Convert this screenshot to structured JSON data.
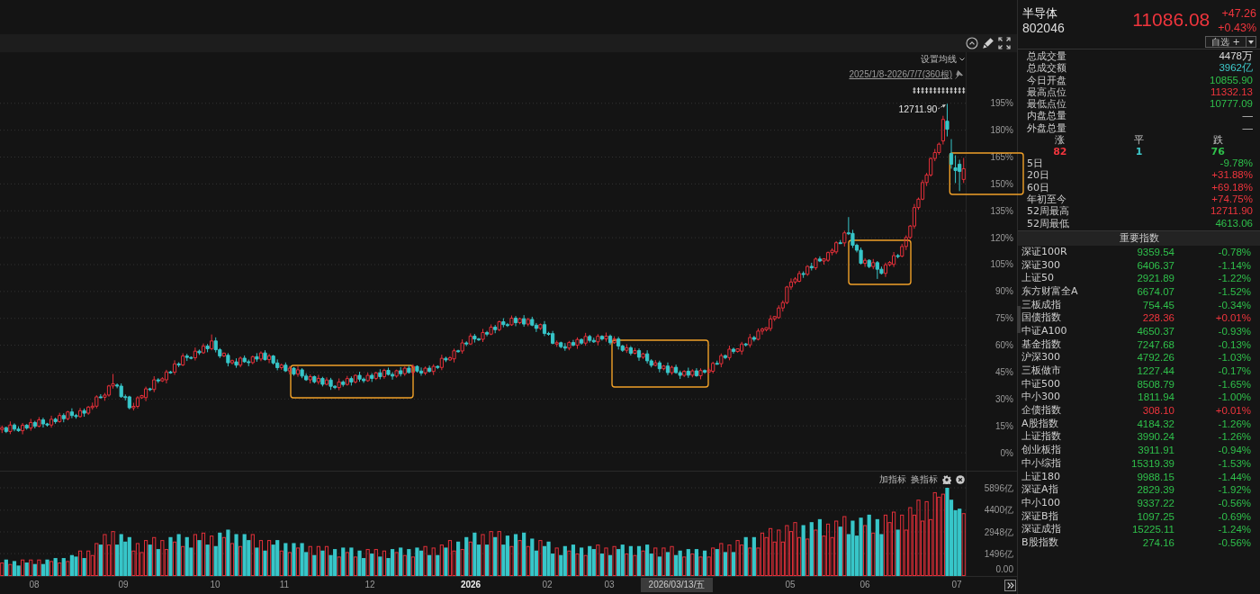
{
  "price_chart": {
    "ma_setting": "设置均线",
    "date_range": "2025/1/8-2026/7/7(360根)",
    "chart_data": {
      "type": "candlestick",
      "grid": true,
      "ylim": [
        -10,
        223.5
      ],
      "yticks": [
        {
          "value": 195,
          "label": "195%"
        },
        {
          "value": 180,
          "label": "180%"
        },
        {
          "value": 165,
          "label": "165%"
        },
        {
          "value": 150,
          "label": "150%"
        },
        {
          "value": 135,
          "label": "135%"
        },
        {
          "value": 120,
          "label": "120%"
        },
        {
          "value": 105,
          "label": "105%"
        },
        {
          "value": 90,
          "label": "90%"
        },
        {
          "value": 75,
          "label": "75%"
        },
        {
          "value": 60,
          "label": "60%"
        },
        {
          "value": 45,
          "label": "45%"
        },
        {
          "value": 30,
          "label": "30%"
        },
        {
          "value": 15,
          "label": "15%"
        },
        {
          "value": 0,
          "label": "0%"
        }
      ],
      "annotations": [
        {
          "text": "12711.90"
        }
      ],
      "categories": [
        null,
        null,
        null,
        null,
        null,
        null,
        null,
        null,
        null,
        null,
        null,
        null,
        null,
        null,
        null,
        null,
        null,
        null,
        null,
        null,
        null,
        null,
        null,
        null,
        null,
        null,
        null,
        null,
        null,
        null,
        null,
        null,
        null,
        null,
        null,
        null,
        null,
        null,
        null,
        null,
        null,
        null,
        null,
        null,
        null,
        null,
        null,
        null,
        null,
        null,
        null,
        null,
        null,
        null,
        null,
        null,
        null,
        null,
        null,
        null,
        null,
        null,
        null,
        null,
        null,
        null,
        null,
        null,
        null,
        null,
        null,
        null,
        null,
        null,
        null,
        null,
        null,
        null,
        null,
        null,
        null,
        null,
        null,
        null,
        null,
        null,
        null,
        null,
        null,
        null,
        null,
        null,
        null,
        null,
        null,
        null,
        null,
        null,
        null,
        null,
        null,
        null,
        null,
        null,
        null,
        null,
        null,
        null,
        null,
        null,
        null,
        null,
        null,
        null,
        null,
        null,
        null,
        null,
        null,
        null,
        null,
        null,
        null,
        null,
        null,
        null,
        null,
        null,
        null,
        null,
        null,
        null,
        null,
        null,
        null,
        null,
        null,
        null,
        null,
        null,
        null,
        null,
        null,
        null,
        null,
        null,
        null,
        null,
        null,
        null,
        null,
        null,
        null,
        null,
        null,
        null,
        null,
        null,
        null,
        null,
        null,
        null,
        null,
        null,
        null,
        null,
        null,
        null,
        null,
        null,
        null,
        null,
        null,
        null,
        null,
        null,
        null,
        null,
        null,
        null,
        null,
        null,
        null,
        null,
        null,
        null,
        null,
        null,
        null,
        null,
        null,
        null,
        null,
        null,
        null,
        null,
        null,
        null,
        null,
        null,
        null,
        null,
        null,
        null,
        null,
        null,
        null,
        null,
        null,
        null,
        null,
        null,
        null,
        null,
        null,
        null,
        null,
        null,
        null,
        null,
        null,
        null,
        null,
        null,
        null,
        null,
        null,
        null,
        null,
        null,
        null,
        null,
        null,
        null,
        null
      ],
      "ohlc": [
        [
          13.0,
          15.2,
          11.0,
          14.0
        ],
        [
          14.0,
          14.6,
          11.0,
          11.9
        ],
        [
          11.9,
          17.5,
          10.4,
          15.5
        ],
        [
          15.5,
          16.4,
          12.0,
          13.2
        ],
        [
          13.2,
          14.7,
          11.7,
          12.3
        ],
        [
          12.3,
          16.6,
          10.3,
          15.4
        ],
        [
          15.4,
          16.0,
          12.9,
          13.8
        ],
        [
          13.8,
          18.9,
          12.3,
          16.9
        ],
        [
          16.9,
          17.8,
          13.6,
          14.8
        ],
        [
          14.8,
          19.9,
          14.2,
          18.4
        ],
        [
          18.4,
          19.6,
          14.1,
          16.1
        ],
        [
          16.1,
          16.7,
          14.6,
          15.5
        ],
        [
          15.5,
          20.7,
          14.0,
          18.7
        ],
        [
          18.7,
          19.6,
          16.2,
          17.4
        ],
        [
          17.4,
          22.3,
          16.8,
          20.8
        ],
        [
          20.8,
          22.0,
          17.0,
          19.0
        ],
        [
          19.0,
          23.4,
          18.1,
          22.8
        ],
        [
          22.8,
          24.8,
          19.3,
          20.8
        ],
        [
          20.8,
          21.7,
          19.0,
          20.2
        ],
        [
          20.2,
          25.0,
          19.6,
          23.5
        ],
        [
          23.5,
          24.7,
          20.1,
          22.1
        ],
        [
          22.1,
          26.1,
          21.2,
          25.5
        ],
        [
          25.5,
          28.0,
          24.0,
          26.0
        ],
        [
          26.0,
          32.1,
          24.8,
          31.2
        ],
        [
          31.2,
          32.7,
          30.4,
          31.0
        ],
        [
          31.0,
          33.4,
          29.0,
          32.2
        ],
        [
          32.2,
          37.9,
          31.3,
          37.3
        ],
        [
          37.3,
          44.0,
          35.8,
          38.5
        ],
        [
          37.8,
          38.7,
          36.0,
          37.2
        ],
        [
          37.2,
          38.7,
          30.7,
          31.3
        ],
        [
          31.3,
          32.5,
          29.2,
          31.2
        ],
        [
          31.2,
          31.8,
          24.2,
          25.1
        ],
        [
          25.1,
          27.9,
          23.6,
          25.9
        ],
        [
          25.9,
          31.6,
          24.7,
          30.7
        ],
        [
          30.7,
          32.3,
          30.1,
          31.9
        ],
        [
          30.8,
          36.9,
          28.8,
          35.7
        ],
        [
          35.7,
          36.3,
          34.4,
          35.3
        ],
        [
          35.3,
          42.7,
          33.8,
          40.7
        ],
        [
          40.7,
          41.6,
          38.9,
          40.1
        ],
        [
          40.1,
          42.2,
          39.5,
          41.3
        ],
        [
          40.7,
          46.3,
          38.7,
          45.1
        ],
        [
          45.1,
          45.7,
          44.1,
          45.0
        ],
        [
          45.0,
          51.6,
          43.5,
          49.6
        ],
        [
          49.6,
          50.5,
          47.8,
          49.0
        ],
        [
          49.0,
          55.5,
          48.4,
          54.0
        ],
        [
          54.0,
          55.2,
          51.2,
          53.2
        ],
        [
          53.2,
          53.8,
          52.1,
          53.0
        ],
        [
          53.0,
          58.7,
          51.5,
          56.7
        ],
        [
          56.7,
          57.6,
          54.6,
          55.8
        ],
        [
          55.8,
          61.0,
          55.2,
          59.5
        ],
        [
          59.5,
          60.7,
          56.1,
          58.1
        ],
        [
          58.1,
          66.0,
          57.2,
          62.4
        ],
        [
          62.4,
          64.4,
          56.0,
          57.5
        ],
        [
          57.5,
          58.4,
          52.8,
          54.0
        ],
        [
          54.0,
          55.9,
          53.4,
          55.6
        ],
        [
          54.4,
          55.6,
          48.2,
          50.2
        ],
        [
          50.2,
          52.0,
          49.3,
          51.4
        ],
        [
          50.7,
          52.7,
          47.4,
          48.9
        ],
        [
          48.9,
          53.7,
          47.7,
          52.8
        ],
        [
          52.8,
          54.3,
          50.2,
          50.8
        ],
        [
          50.8,
          52.0,
          48.3,
          50.3
        ],
        [
          50.3,
          54.2,
          49.4,
          53.6
        ],
        [
          53.6,
          55.6,
          50.8,
          52.3
        ],
        [
          52.3,
          56.6,
          51.1,
          55.7
        ],
        [
          55.7,
          57.2,
          51.4,
          52.0
        ],
        [
          52.0,
          55.2,
          50.0,
          54.0
        ],
        [
          54.0,
          54.6,
          49.2,
          50.1
        ],
        [
          50.1,
          52.1,
          46.0,
          47.5
        ],
        [
          47.5,
          49.8,
          46.3,
          48.9
        ],
        [
          48.9,
          50.4,
          45.1,
          45.7
        ],
        [
          45.7,
          48.4,
          43.7,
          47.2
        ],
        [
          47.2,
          47.8,
          43.0,
          43.9
        ],
        [
          43.9,
          48.3,
          42.4,
          46.3
        ],
        [
          46.3,
          47.2,
          41.6,
          42.8
        ],
        [
          42.8,
          44.3,
          40.1,
          40.7
        ],
        [
          40.7,
          43.7,
          38.7,
          42.5
        ],
        [
          42.5,
          43.1,
          38.7,
          39.6
        ],
        [
          39.6,
          43.5,
          38.1,
          41.5
        ],
        [
          41.5,
          42.4,
          37.0,
          38.2
        ],
        [
          38.2,
          42.1,
          37.6,
          40.6
        ],
        [
          40.6,
          41.8,
          35.1,
          37.1
        ],
        [
          37.1,
          37.7,
          35.5,
          36.4
        ],
        [
          36.4,
          41.5,
          34.9,
          39.5
        ],
        [
          39.5,
          40.4,
          36.9,
          38.1
        ],
        [
          38.1,
          42.9,
          37.5,
          41.4
        ],
        [
          41.4,
          42.6,
          37.5,
          39.5
        ],
        [
          39.5,
          43.8,
          38.6,
          43.2
        ],
        [
          43.2,
          45.2,
          39.6,
          41.1
        ],
        [
          41.1,
          42.0,
          39.0,
          40.2
        ],
        [
          40.2,
          44.7,
          39.6,
          43.2
        ],
        [
          43.2,
          44.4,
          39.5,
          41.5
        ],
        [
          41.5,
          45.2,
          40.6,
          44.6
        ],
        [
          44.6,
          46.6,
          41.0,
          42.5
        ],
        [
          42.5,
          46.9,
          41.3,
          46.0
        ],
        [
          46.0,
          47.5,
          43.1,
          43.7
        ],
        [
          43.7,
          44.9,
          40.8,
          42.8
        ],
        [
          42.8,
          46.4,
          41.9,
          45.8
        ],
        [
          45.8,
          47.8,
          42.6,
          44.1
        ],
        [
          44.1,
          48.1,
          42.9,
          47.2
        ],
        [
          47.2,
          48.7,
          44.2,
          44.8
        ],
        [
          44.8,
          49.4,
          42.8,
          48.2
        ],
        [
          48.2,
          48.8,
          44.7,
          45.6
        ],
        [
          45.6,
          47.6,
          43.0,
          44.5
        ],
        [
          44.5,
          48.1,
          43.3,
          47.2
        ],
        [
          47.2,
          48.7,
          44.8,
          45.4
        ],
        [
          45.4,
          49.4,
          43.4,
          48.2
        ],
        [
          48.2,
          48.8,
          46.7,
          47.6
        ],
        [
          47.6,
          54.7,
          46.1,
          52.7
        ],
        [
          52.7,
          53.6,
          50.6,
          51.8
        ],
        [
          51.8,
          53.9,
          51.2,
          53.0
        ],
        [
          52.4,
          58.1,
          50.4,
          56.9
        ],
        [
          56.9,
          57.5,
          55.9,
          56.8
        ],
        [
          56.8,
          63.3,
          55.3,
          61.3
        ],
        [
          61.3,
          62.2,
          59.5,
          60.7
        ],
        [
          60.7,
          66.6,
          60.1,
          65.1
        ],
        [
          65.1,
          66.3,
          61.5,
          63.5
        ],
        [
          63.5,
          64.1,
          62.4,
          63.3
        ],
        [
          63.3,
          69.1,
          61.8,
          67.1
        ],
        [
          67.1,
          68.0,
          65.0,
          66.2
        ],
        [
          66.2,
          71.6,
          65.6,
          70.1
        ],
        [
          70.1,
          71.3,
          66.7,
          68.7
        ],
        [
          68.7,
          73.7,
          67.8,
          73.1
        ],
        [
          73.1,
          75.1,
          70.0,
          71.5
        ],
        [
          71.5,
          72.4,
          70.2,
          71.4
        ],
        [
          71.4,
          76.6,
          70.8,
          75.1
        ],
        [
          75.1,
          76.3,
          70.6,
          72.6
        ],
        [
          72.6,
          75.4,
          71.7,
          74.8
        ],
        [
          74.8,
          76.8,
          70.3,
          71.8
        ],
        [
          71.8,
          75.3,
          70.6,
          74.4
        ],
        [
          74.4,
          75.9,
          70.6,
          71.2
        ],
        [
          71.2,
          72.4,
          67.4,
          69.4
        ],
        [
          69.4,
          72.1,
          68.5,
          71.5
        ],
        [
          71.5,
          73.5,
          65.1,
          66.6
        ],
        [
          66.6,
          67.5,
          65.3,
          66.5
        ],
        [
          66.5,
          68.0,
          60.5,
          61.1
        ],
        [
          61.1,
          62.6,
          59.1,
          61.4
        ],
        [
          61.4,
          62.0,
          58.3,
          59.2
        ],
        [
          59.2,
          61.2,
          56.9,
          58.4
        ],
        [
          58.4,
          62.4,
          57.2,
          61.5
        ],
        [
          61.5,
          63.0,
          59.4,
          60.0
        ],
        [
          60.0,
          64.4,
          58.0,
          63.2
        ],
        [
          63.2,
          63.8,
          60.3,
          61.2
        ],
        [
          61.2,
          66.9,
          59.7,
          64.9
        ],
        [
          64.9,
          65.8,
          61.5,
          62.7
        ],
        [
          62.7,
          64.2,
          61.3,
          61.9
        ],
        [
          61.9,
          66.2,
          59.9,
          65.0
        ],
        [
          65.0,
          65.6,
          62.6,
          63.5
        ],
        [
          63.5,
          67.1,
          62.0,
          65.1
        ],
        [
          65.1,
          66.0,
          60.2,
          61.4
        ],
        [
          61.4,
          65.0,
          60.8,
          63.5
        ],
        [
          63.5,
          64.7,
          57.6,
          59.6
        ],
        [
          59.6,
          60.2,
          56.3,
          57.2
        ],
        [
          57.2,
          60.6,
          55.7,
          58.6
        ],
        [
          58.6,
          59.5,
          54.3,
          55.5
        ],
        [
          55.5,
          58.5,
          54.9,
          57.0
        ],
        [
          57.0,
          58.2,
          51.3,
          53.3
        ],
        [
          53.3,
          55.8,
          52.4,
          55.2
        ],
        [
          55.2,
          57.2,
          49.8,
          51.3
        ],
        [
          51.3,
          52.2,
          47.6,
          48.8
        ],
        [
          48.8,
          51.7,
          48.2,
          50.2
        ],
        [
          50.2,
          51.4,
          44.9,
          46.9
        ],
        [
          46.9,
          49.0,
          46.0,
          48.4
        ],
        [
          48.4,
          50.4,
          43.2,
          44.7
        ],
        [
          44.7,
          48.6,
          43.5,
          47.7
        ],
        [
          47.7,
          49.2,
          44.1,
          44.7
        ],
        [
          44.7,
          45.9,
          41.2,
          43.2
        ],
        [
          43.2,
          46.1,
          42.3,
          45.5
        ],
        [
          45.5,
          47.5,
          41.8,
          43.3
        ],
        [
          43.3,
          46.6,
          42.1,
          45.7
        ],
        [
          45.7,
          47.2,
          42.4,
          43.0
        ],
        [
          43.0,
          47.1,
          41.0,
          45.9
        ],
        [
          45.9,
          46.5,
          44.1,
          45.0
        ],
        [
          45.0,
          47.5,
          43.5,
          46.2
        ],
        [
          45.5,
          50.8,
          44.3,
          49.9
        ],
        [
          49.9,
          51.4,
          49.1,
          49.7
        ],
        [
          49.7,
          55.4,
          47.7,
          54.2
        ],
        [
          54.2,
          54.8,
          52.2,
          53.1
        ],
        [
          53.1,
          59.8,
          51.6,
          57.8
        ],
        [
          57.8,
          58.7,
          55.3,
          56.5
        ],
        [
          56.5,
          58.2,
          55.9,
          58.0
        ],
        [
          56.7,
          61.9,
          54.7,
          60.7
        ],
        [
          60.7,
          61.3,
          59.3,
          60.2
        ],
        [
          60.2,
          66.3,
          58.7,
          64.3
        ],
        [
          64.3,
          65.2,
          62.1,
          63.3
        ],
        [
          63.3,
          69.4,
          62.7,
          67.9
        ],
        [
          67.9,
          69.8,
          65.9,
          69.0
        ],
        [
          68.6,
          69.9,
          67.7,
          69.8
        ],
        [
          69.3,
          76.7,
          67.8,
          74.7
        ],
        [
          74.7,
          76.3,
          73.5,
          76.0
        ],
        [
          75.4,
          82.3,
          74.8,
          80.8
        ],
        [
          80.8,
          85.0,
          78.8,
          83.8
        ],
        [
          83.8,
          93.1,
          82.9,
          92.5
        ],
        [
          92.5,
          97.3,
          91.0,
          95.3
        ],
        [
          95.3,
          98.0,
          94.1,
          97.0
        ],
        [
          95.7,
          101.5,
          95.1,
          100.0
        ],
        [
          100.0,
          101.2,
          97.6,
          99.6
        ],
        [
          99.6,
          104.6,
          98.7,
          104.0
        ],
        [
          104.0,
          106.0,
          101.7,
          103.2
        ],
        [
          103.2,
          109.0,
          102.0,
          108.1
        ],
        [
          108.1,
          109.6,
          106.4,
          107.0
        ],
        [
          107.0,
          108.6,
          105.0,
          108.2
        ],
        [
          107.4,
          112.3,
          106.5,
          111.7
        ],
        [
          111.7,
          114.1,
          110.2,
          113.0
        ],
        [
          112.1,
          118.1,
          110.9,
          117.2
        ],
        [
          117.2,
          118.7,
          116.5,
          117.1
        ],
        [
          117.1,
          123.9,
          115.1,
          122.7
        ],
        [
          122.7,
          131.5,
          121.5,
          122.4
        ],
        [
          122.4,
          124.4,
          114.3,
          115.8
        ],
        [
          115.8,
          116.7,
          111.8,
          113.0
        ],
        [
          113.0,
          114.5,
          105.1,
          105.7
        ],
        [
          105.7,
          108.6,
          103.7,
          107.4
        ],
        [
          107.4,
          108.0,
          103.0,
          103.9
        ],
        [
          103.9,
          108.1,
          102.4,
          106.1
        ],
        [
          106.1,
          107.0,
          97.0,
          102.4
        ],
        [
          102.4,
          103.9,
          99.5,
          100.1
        ],
        [
          100.1,
          106.1,
          98.1,
          104.9
        ],
        [
          104.9,
          107.0,
          104.0,
          106.2
        ],
        [
          105.1,
          112.0,
          103.6,
          110.0
        ],
        [
          110.0,
          110.9,
          108.5,
          109.7
        ],
        [
          109.7,
          116.6,
          109.1,
          115.1
        ],
        [
          115.1,
          121.3,
          113.1,
          120.1
        ],
        [
          120.1,
          127.1,
          119.2,
          126.5
        ],
        [
          126.5,
          138.8,
          125.0,
          136.8
        ],
        [
          136.8,
          142.4,
          135.6,
          141.5
        ],
        [
          141.5,
          152.3,
          140.9,
          150.8
        ],
        [
          150.8,
          156.2,
          148.8,
          155.0
        ],
        [
          155.0,
          164.8,
          154.1,
          164.2
        ],
        [
          164.2,
          169.5,
          162.7,
          167.5
        ],
        [
          167.5,
          173.1,
          166.3,
          172.2
        ],
        [
          174.0,
          188.0,
          172.0,
          186.0
        ],
        [
          185.0,
          194.7,
          176.5,
          180.5
        ],
        [
          167.0,
          175.0,
          158.5,
          161.0
        ],
        [
          159.0,
          166.0,
          150.5,
          157.5
        ],
        [
          161.0,
          163.5,
          146.0,
          157.0
        ],
        [
          152.5,
          164.5,
          150.5,
          158.5
        ]
      ]
    }
  },
  "volume_chart": {
    "add_indicator": "加指标",
    "switch_indicator": "换指标",
    "chart_data": {
      "type": "bar",
      "grid": true,
      "ylim": [
        0,
        6979
      ],
      "yticks": [
        {
          "value": 5896,
          "label": "5896亿"
        },
        {
          "value": 4400,
          "label": "4400亿"
        },
        {
          "value": 2948,
          "label": "2948亿"
        },
        {
          "value": 1496,
          "label": "1496亿"
        },
        {
          "value": 0,
          "label": "0.00"
        }
      ],
      "categories": [
        null,
        null,
        null,
        null,
        null,
        null,
        null,
        null,
        null,
        null,
        null,
        null,
        null,
        null,
        null,
        null,
        null,
        null,
        null,
        null,
        null,
        null,
        null,
        null,
        null,
        null,
        null,
        null,
        null,
        null,
        null,
        null,
        null,
        null,
        null,
        null,
        null,
        null,
        null,
        null,
        null,
        null,
        null,
        null,
        null,
        null,
        null,
        null,
        null,
        null,
        null,
        null,
        null,
        null,
        null,
        null,
        null,
        null,
        null,
        null,
        null,
        null,
        null,
        null,
        null,
        null,
        null,
        null,
        null,
        null,
        null,
        null,
        null,
        null,
        null,
        null,
        null,
        null,
        null,
        null,
        null,
        null,
        null,
        null,
        null,
        null,
        null,
        null,
        null,
        null,
        null,
        null,
        null,
        null,
        null,
        null,
        null,
        null,
        null,
        null,
        null,
        null,
        null,
        null,
        null,
        null,
        null,
        null,
        null,
        null,
        null,
        null,
        null,
        null,
        null,
        null,
        null,
        null,
        null,
        null,
        null,
        null,
        null,
        null,
        null,
        null,
        null,
        null,
        null,
        null,
        null,
        null,
        null,
        null,
        null,
        null,
        null,
        null,
        null,
        null,
        null,
        null,
        null,
        null,
        null,
        null,
        null,
        null,
        null,
        null,
        null,
        null,
        null,
        null,
        null,
        null,
        null,
        null,
        null,
        null,
        null,
        null,
        null,
        null,
        null,
        null,
        null,
        null,
        null,
        null,
        null,
        null,
        null,
        null,
        null,
        null,
        null,
        null,
        null,
        null,
        null,
        null,
        null,
        null,
        null,
        null,
        null,
        null,
        null,
        null,
        null,
        null,
        null,
        null,
        null,
        null,
        null,
        null,
        null,
        null,
        null,
        null,
        null,
        null,
        null,
        null,
        null,
        null,
        null,
        null,
        null,
        null,
        null,
        null,
        null,
        null,
        null,
        null,
        null,
        null,
        null,
        null,
        null,
        null,
        null,
        null,
        null,
        null,
        null,
        null,
        null,
        null,
        null,
        null,
        null
      ],
      "values": [
        900,
        1100,
        800,
        1000,
        700,
        1100,
        900,
        1100,
        800,
        1100,
        800,
        1100,
        1000,
        1200,
        900,
        1200,
        1000,
        1400,
        1300,
        1700,
        1200,
        1700,
        1400,
        2200,
        2100,
        2800,
        2100,
        3000,
        2100,
        2800,
        2300,
        2600,
        1700,
        2200,
        1600,
        2400,
        2100,
        2600,
        1800,
        2400,
        1800,
        2600,
        2300,
        2800,
        2000,
        2600,
        1900,
        2800,
        2400,
        2900,
        2100,
        2700,
        2000,
        2900,
        2600,
        3100,
        2200,
        2800,
        2000,
        2800,
        2400,
        2800,
        1900,
        2400,
        1700,
        2400,
        2100,
        2400,
        1700,
        2200,
        1600,
        2200,
        1900,
        2200,
        1600,
        2000,
        1400,
        2000,
        1700,
        2000,
        1400,
        1800,
        1300,
        1900,
        1600,
        1900,
        1300,
        1700,
        1200,
        1800,
        1500,
        1800,
        1300,
        1700,
        1200,
        1800,
        1600,
        1900,
        1400,
        1800,
        1300,
        1900,
        1700,
        2000,
        1400,
        1900,
        1400,
        2100,
        1900,
        2400,
        1700,
        2300,
        1800,
        2600,
        2300,
        2900,
        2100,
        2800,
        2100,
        3000,
        2600,
        3000,
        2100,
        2700,
        2000,
        2800,
        2400,
        2900,
        2000,
        2500,
        1700,
        2400,
        2000,
        2300,
        1500,
        1900,
        1400,
        2000,
        1700,
        2100,
        1500,
        1900,
        1400,
        2000,
        1800,
        2100,
        1500,
        1900,
        1400,
        2000,
        1800,
        2100,
        1500,
        2000,
        1400,
        2000,
        1700,
        2100,
        1500,
        1900,
        1300,
        1900,
        1600,
        2000,
        1400,
        1700,
        1300,
        1800,
        1500,
        1800,
        1300,
        1700,
        1300,
        1900,
        1800,
        2200,
        1600,
        2100,
        1600,
        2400,
        2100,
        2600,
        1900,
        2600,
        1900,
        2900,
        2600,
        3200,
        2300,
        3100,
        2300,
        3400,
        3000,
        3600,
        2600,
        3400,
        2500,
        3600,
        3100,
        3800,
        2700,
        3500,
        2600,
        3700,
        3300,
        4000,
        2800,
        3700,
        2700,
        3900,
        3400,
        4100,
        2900,
        3800,
        2800,
        4100,
        3600,
        4300,
        3100,
        4100,
        3100,
        4600,
        4100,
        5100,
        3700,
        5000,
        3800,
        5600,
        5300,
        5500,
        5896,
        5100,
        4400,
        4500,
        4200
      ]
    }
  },
  "x_axis": {
    "labels": [
      {
        "text": "08",
        "emphasized": false
      },
      {
        "text": "09",
        "emphasized": false
      },
      {
        "text": "10",
        "emphasized": false
      },
      {
        "text": "11",
        "emphasized": false
      },
      {
        "text": "12",
        "emphasized": false
      },
      {
        "text": "2026",
        "emphasized": true
      },
      {
        "text": "02",
        "emphasized": false
      },
      {
        "text": "03",
        "emphasized": false
      },
      {
        "text": "05",
        "emphasized": false
      },
      {
        "text": "06",
        "emphasized": false
      },
      {
        "text": "07",
        "emphasized": false
      }
    ],
    "cursor_date": "2026/03/13/五"
  },
  "quote": {
    "name": "半导体",
    "code": "802046",
    "price": "11086.08",
    "change": "+47.26",
    "change_pct": "+0.43%",
    "rising": true,
    "watchlist": "自选 +"
  },
  "stats": [
    {
      "label": "总成交量",
      "value": "4478万",
      "color": "#dedede"
    },
    {
      "label": "总成交额",
      "value": "3962亿",
      "color": "#3ec9cb"
    },
    {
      "label": "今日开盘",
      "value": "10855.90",
      "color": "#2fc04b"
    },
    {
      "label": "最高点位",
      "value": "11332.13",
      "color": "#f0353d"
    },
    {
      "label": "最低点位",
      "value": "10777.09",
      "color": "#2fc04b"
    },
    {
      "label": "内盘总量",
      "value": "—"
    },
    {
      "label": "外盘总量",
      "value": "—"
    }
  ],
  "breadth": [
    {
      "label": "涨",
      "count": "82",
      "color": "#f0353d"
    },
    {
      "label": "平",
      "count": "1",
      "color": "#3ec9cb"
    },
    {
      "label": "跌",
      "count": "76",
      "color": "#2fc04b"
    }
  ],
  "performance": [
    {
      "label": "5日",
      "value": "-9.78%",
      "rising": false
    },
    {
      "label": "20日",
      "value": "+31.88%",
      "rising": true
    },
    {
      "label": "60日",
      "value": "+69.18%",
      "rising": true
    },
    {
      "label": "年初至今",
      "value": "+74.75%",
      "rising": true
    },
    {
      "label": "52周最高",
      "value": "12711.90",
      "rising": true
    },
    {
      "label": "52周最低",
      "value": "4613.06",
      "rising": false
    }
  ],
  "indices": {
    "title": "重要指数",
    "rows": [
      {
        "name": "深证100R",
        "value": "9359.54",
        "change": "-0.78%",
        "rising": false
      },
      {
        "name": "深证300",
        "value": "6406.37",
        "change": "-1.14%",
        "rising": false
      },
      {
        "name": "上证50",
        "value": "2921.89",
        "change": "-1.22%",
        "rising": false
      },
      {
        "name": "东方财富全A",
        "value": "6674.07",
        "change": "-1.52%",
        "rising": false
      },
      {
        "name": "三板成指",
        "value": "754.45",
        "change": "-0.34%",
        "rising": false
      },
      {
        "name": "国债指数",
        "value": "228.36",
        "change": "+0.01%",
        "rising": true
      },
      {
        "name": "中证A100",
        "value": "4650.37",
        "change": "-0.93%",
        "rising": false
      },
      {
        "name": "基金指数",
        "value": "7247.68",
        "change": "-0.13%",
        "rising": false
      },
      {
        "name": "沪深300",
        "value": "4792.26",
        "change": "-1.03%",
        "rising": false
      },
      {
        "name": "三板做市",
        "value": "1227.44",
        "change": "-0.17%",
        "rising": false
      },
      {
        "name": "中证500",
        "value": "8508.79",
        "change": "-1.65%",
        "rising": false
      },
      {
        "name": "中小300",
        "value": "1811.94",
        "change": "-1.00%",
        "rising": false
      },
      {
        "name": "企债指数",
        "value": "308.10",
        "change": "+0.01%",
        "rising": true
      },
      {
        "name": "A股指数",
        "value": "4184.32",
        "change": "-1.26%",
        "rising": false
      },
      {
        "name": "上证指数",
        "value": "3990.24",
        "change": "-1.26%",
        "rising": false
      },
      {
        "name": "创业板指",
        "value": "3911.91",
        "change": "-0.94%",
        "rising": false
      },
      {
        "name": "中小综指",
        "value": "15319.39",
        "change": "-1.53%",
        "rising": false
      },
      {
        "name": "上证180",
        "value": "9988.15",
        "change": "-1.44%",
        "rising": false
      },
      {
        "name": "深证A指",
        "value": "2829.39",
        "change": "-1.92%",
        "rising": false
      },
      {
        "name": "中小100",
        "value": "9337.22",
        "change": "-0.56%",
        "rising": false
      },
      {
        "name": "深证B指",
        "value": "1097.25",
        "change": "-0.69%",
        "rising": false
      },
      {
        "name": "深证成指",
        "value": "15225.11",
        "change": "-1.24%",
        "rising": false
      },
      {
        "name": "B股指数",
        "value": "274.16",
        "change": "-0.56%",
        "rising": false
      }
    ]
  }
}
